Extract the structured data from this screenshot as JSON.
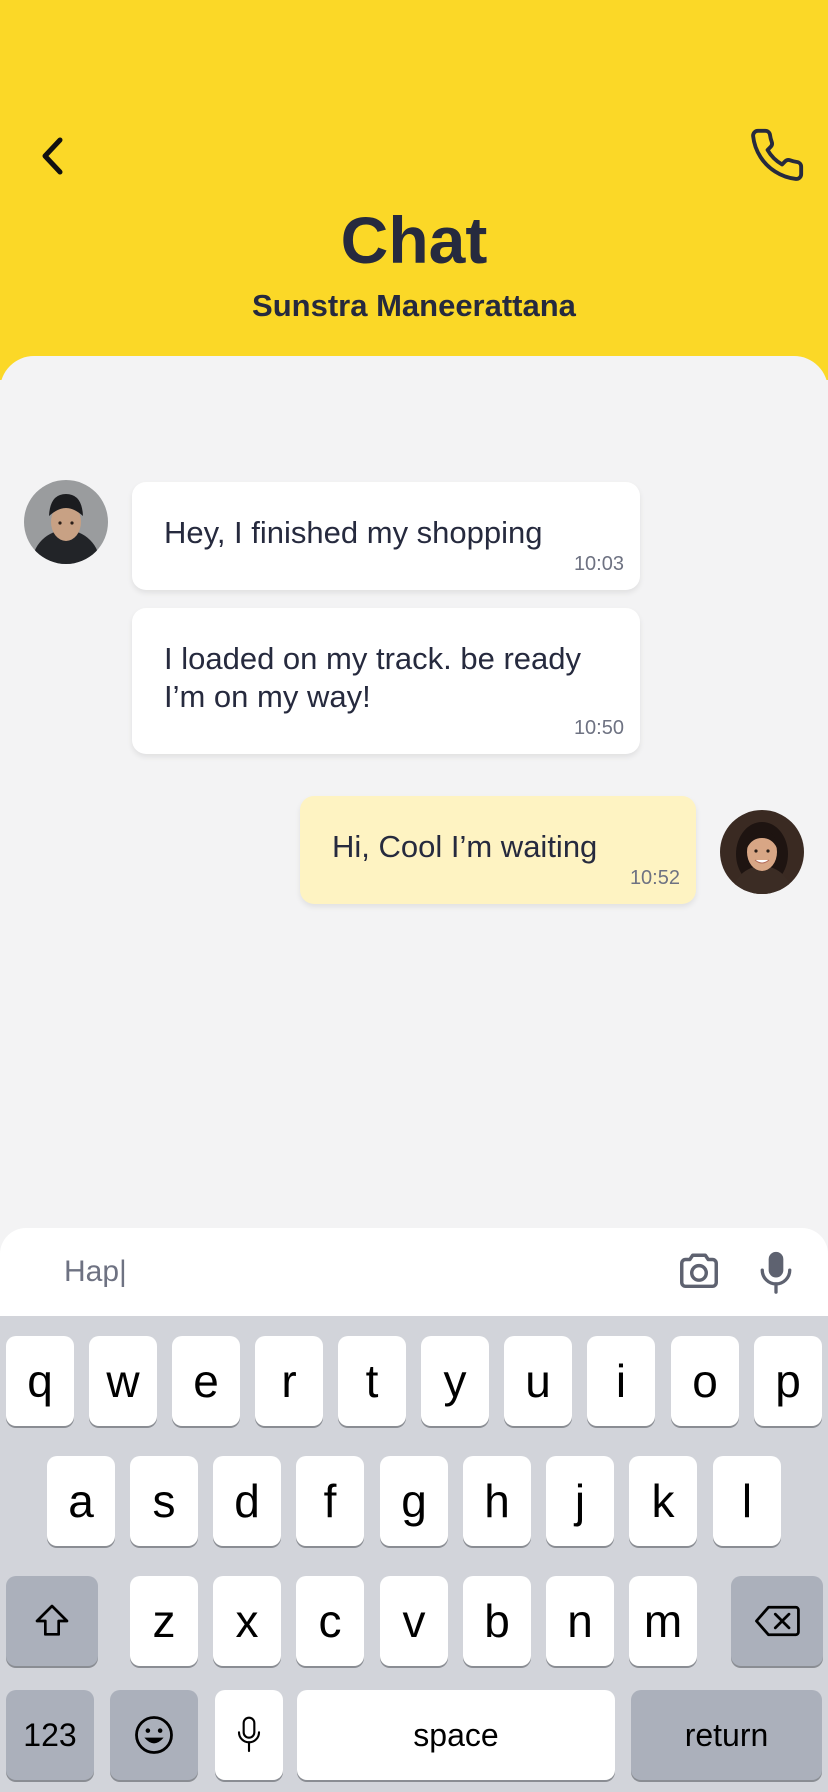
{
  "header": {
    "title": "Chat",
    "contact_name": "Sunstra Maneerattana",
    "back_icon": "chevron-left-icon",
    "call_icon": "phone-icon",
    "background_color": "#FBD827"
  },
  "messages": [
    {
      "sender": "contact",
      "text": "Hey, I finished my shopping",
      "time": "10:03"
    },
    {
      "sender": "contact",
      "text": "I loaded on my track. be ready I’m on my way!",
      "time": "10:50"
    },
    {
      "sender": "me",
      "text": "Hi, Cool I’m waiting",
      "time": "10:52"
    }
  ],
  "composer": {
    "value": "Hap|",
    "camera_icon": "camera-icon",
    "mic_icon": "microphone-icon"
  },
  "keyboard": {
    "row1": [
      "q",
      "w",
      "e",
      "r",
      "t",
      "y",
      "u",
      "i",
      "o",
      "p"
    ],
    "row2": [
      "a",
      "s",
      "d",
      "f",
      "g",
      "h",
      "j",
      "k",
      "l"
    ],
    "row3": [
      "z",
      "x",
      "c",
      "v",
      "b",
      "n",
      "m"
    ],
    "numbers_label": "123",
    "space_label": "space",
    "return_label": "return"
  },
  "colors": {
    "accent": "#FBD827",
    "my_bubble": "#FEF3C2",
    "contact_bubble": "#FFFFFF",
    "background": "#F3F3F4"
  }
}
